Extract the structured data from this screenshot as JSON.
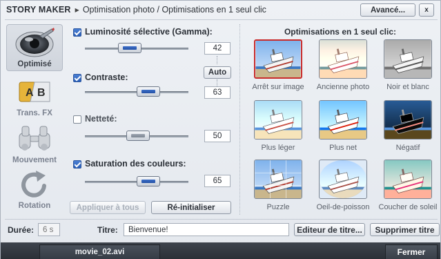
{
  "header": {
    "app_name": "STORY MAKER",
    "breadcrumb": "Optimisation photo / Optimisations en 1 seul clic",
    "advanced_label": "Avancé...",
    "close_label": "x"
  },
  "nav": {
    "items": [
      {
        "label": "Optimisé",
        "icon": "eye-icon",
        "active": true
      },
      {
        "label": "Trans. FX",
        "icon": "ab-transition-icon",
        "active": false
      },
      {
        "label": "Mouvement",
        "icon": "binoculars-icon",
        "active": false
      },
      {
        "label": "Rotation",
        "icon": "rotate-arrow-icon",
        "active": false
      }
    ]
  },
  "controls": {
    "brightness": {
      "label": "Luminosité sélective (Gamma):",
      "checked": true,
      "value": "42",
      "level": 0.42
    },
    "auto_label": "Auto",
    "contrast": {
      "label": "Contraste:",
      "checked": true,
      "value": "63",
      "level": 0.63
    },
    "sharpness": {
      "label": "Netteté:",
      "checked": false,
      "value": "50",
      "level": 0.5
    },
    "saturation": {
      "label": "Saturation des couleurs:",
      "checked": true,
      "value": "65",
      "level": 0.65
    },
    "apply_all_label": "Appliquer à tous",
    "reset_label": "Ré-initialiser"
  },
  "presets": {
    "title": "Optimisations en 1 seul clic:",
    "items": [
      {
        "label": "Arrêt sur image",
        "style": "normal",
        "selected": true
      },
      {
        "label": "Ancienne photo",
        "style": "sepia-pink",
        "selected": false
      },
      {
        "label": "Noir et blanc",
        "style": "grayscale",
        "selected": false
      },
      {
        "label": "Plus léger",
        "style": "light",
        "selected": false
      },
      {
        "label": "Plus net",
        "style": "sharp",
        "selected": false
      },
      {
        "label": "Négatif",
        "style": "negative",
        "selected": false
      },
      {
        "label": "Puzzle",
        "style": "puzzle",
        "selected": false
      },
      {
        "label": "Oeil-de-poisson",
        "style": "fisheye",
        "selected": false
      },
      {
        "label": "Coucher de soleil",
        "style": "sunset",
        "selected": false
      }
    ]
  },
  "bottom": {
    "duration_label": "Durée:",
    "duration_value": "6 s",
    "title_label": "Titre:",
    "title_value": "Bienvenue!",
    "editor_label": "Editeur de titre...",
    "delete_label": "Supprimer titre"
  },
  "footer": {
    "file_tab": "movie_02.avi",
    "close_label": "Fermer"
  },
  "colors": {
    "accent_blue": "#2b5fb6",
    "selected_border": "#c92b2b",
    "footer_bg": "#2b3037"
  }
}
